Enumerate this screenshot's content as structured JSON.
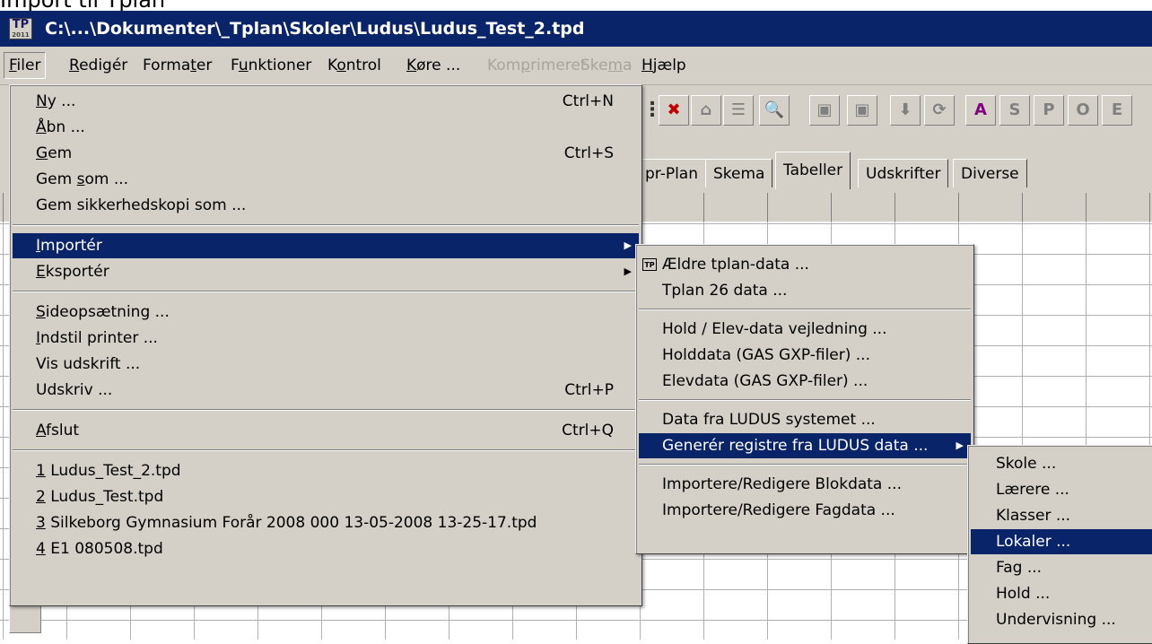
{
  "page_caption": "Import til Tplan",
  "window": {
    "title": "C:\\...\\Dokumenter\\_Tplan\\Skoler\\Ludus\\Ludus_Test_2.tpd",
    "icon_label": "TP",
    "icon_sub": "2011"
  },
  "menubar": [
    {
      "pre": "",
      "mn": "F",
      "post": "iler",
      "state": "active"
    },
    {
      "pre": "",
      "mn": "R",
      "post": "edigér",
      "state": "normal"
    },
    {
      "pre": "Forma",
      "mn": "t",
      "post": "er",
      "state": "normal"
    },
    {
      "pre": "F",
      "mn": "u",
      "post": "nktioner",
      "state": "normal"
    },
    {
      "pre": "K",
      "mn": "o",
      "post": "ntrol",
      "state": "normal"
    },
    {
      "pre": "",
      "mn": "K",
      "post": "øre ...",
      "state": "normal"
    },
    {
      "pre": "Kom",
      "mn": "p",
      "post": "rimeret",
      "state": "disabled"
    },
    {
      "pre": "Ske",
      "mn": "m",
      "post": "a",
      "state": "disabled"
    },
    {
      "pre": "",
      "mn": "H",
      "post": "jælp",
      "state": "normal"
    }
  ],
  "toolbar_buttons": [
    {
      "icon": "x-red-icon",
      "glyph": "✖",
      "color": "#c00000"
    },
    {
      "icon": "house-icon",
      "glyph": "⌂",
      "color": "#808080"
    },
    {
      "icon": "list-icon",
      "glyph": "☰",
      "color": "#808080"
    },
    {
      "icon": "search-person-icon",
      "glyph": "🔍",
      "color": "#c04000"
    },
    {
      "icon": "save-icon",
      "glyph": "▣",
      "color": "#808080"
    },
    {
      "icon": "save-as-icon",
      "glyph": "▣",
      "color": "#808080"
    },
    {
      "icon": "download-icon",
      "glyph": "⬇",
      "color": "#808080"
    },
    {
      "icon": "refresh-icon",
      "glyph": "⟳",
      "color": "#808080"
    },
    {
      "icon": "a-icon",
      "glyph": "A",
      "color": "#800080"
    },
    {
      "icon": "s-icon",
      "glyph": "S",
      "color": "#808080"
    },
    {
      "icon": "p-icon",
      "glyph": "P",
      "color": "#808080"
    },
    {
      "icon": "o-icon",
      "glyph": "O",
      "color": "#808080"
    },
    {
      "icon": "e-icon",
      "glyph": "E",
      "color": "#808080"
    }
  ],
  "tabs": [
    {
      "label": "pr-Plan",
      "selected": false
    },
    {
      "label": "Skema",
      "selected": false
    },
    {
      "label": "Tabeller",
      "selected": true
    },
    {
      "label": "Udskrifter",
      "selected": false
    },
    {
      "label": "Diverse",
      "selected": false
    }
  ],
  "filer_menu": [
    {
      "type": "item",
      "pre": "",
      "mn": "N",
      "post": "y ...",
      "shortcut": "Ctrl+N"
    },
    {
      "type": "item",
      "pre": "",
      "mn": "Å",
      "post": "bn ...",
      "shortcut": ""
    },
    {
      "type": "item",
      "pre": "",
      "mn": "G",
      "post": "em",
      "shortcut": "Ctrl+S"
    },
    {
      "type": "item",
      "pre": "Gem ",
      "mn": "s",
      "post": "om ...",
      "shortcut": ""
    },
    {
      "type": "item",
      "pre": "Gem sikkerhedskopi som ...",
      "mn": "",
      "post": "",
      "shortcut": ""
    },
    {
      "type": "sep"
    },
    {
      "type": "item",
      "pre": "",
      "mn": "I",
      "post": "mportér",
      "shortcut": "",
      "submenu": true,
      "highlight": true
    },
    {
      "type": "item",
      "pre": "",
      "mn": "E",
      "post": "ksportér",
      "shortcut": "",
      "submenu": true
    },
    {
      "type": "sep"
    },
    {
      "type": "item",
      "pre": "",
      "mn": "S",
      "post": "ideopsætning ...",
      "shortcut": ""
    },
    {
      "type": "item",
      "pre": "",
      "mn": "I",
      "post": "ndstil printer ...",
      "shortcut": ""
    },
    {
      "type": "item",
      "pre": "Vis udskrift ...",
      "mn": "",
      "post": "",
      "shortcut": ""
    },
    {
      "type": "item",
      "pre": "Udskriv ...",
      "mn": "",
      "post": "",
      "shortcut": "Ctrl+P"
    },
    {
      "type": "sep"
    },
    {
      "type": "item",
      "pre": "",
      "mn": "A",
      "post": "fslut",
      "shortcut": "Ctrl+Q"
    },
    {
      "type": "sep"
    },
    {
      "type": "item",
      "pre": "",
      "mn": "1",
      "post": " Ludus_Test_2.tpd",
      "shortcut": ""
    },
    {
      "type": "item",
      "pre": "",
      "mn": "2",
      "post": " Ludus_Test.tpd",
      "shortcut": ""
    },
    {
      "type": "item",
      "pre": "",
      "mn": "3",
      "post": " Silkeborg Gymnasium Forår 2008 000 13-05-2008 13-25-17.tpd",
      "shortcut": ""
    },
    {
      "type": "item",
      "pre": "",
      "mn": "4",
      "post": " E1 080508.tpd",
      "shortcut": ""
    }
  ],
  "import_menu": [
    {
      "type": "item",
      "label": "Ældre tplan-data ...",
      "icon": true,
      "icon_label": "TP"
    },
    {
      "type": "item",
      "label": "Tplan 26 data ..."
    },
    {
      "type": "sep"
    },
    {
      "type": "item",
      "label": "Hold / Elev-data vejledning ..."
    },
    {
      "type": "item",
      "label": "Holddata (GAS GXP-filer) ..."
    },
    {
      "type": "item",
      "label": "Elevdata (GAS GXP-filer) ..."
    },
    {
      "type": "sep"
    },
    {
      "type": "item",
      "label": "Data fra LUDUS systemet ..."
    },
    {
      "type": "item",
      "label": "Generér registre fra LUDUS data ...",
      "submenu": true,
      "highlight": true
    },
    {
      "type": "sep"
    },
    {
      "type": "item",
      "label": "Importere/Redigere Blokdata ..."
    },
    {
      "type": "item",
      "label": "Importere/Redigere Fagdata ..."
    }
  ],
  "ludus_menu": [
    {
      "label": "Skole ..."
    },
    {
      "label": "Lærere ..."
    },
    {
      "label": "Klasser ..."
    },
    {
      "label": "Lokaler ...",
      "highlight": true
    },
    {
      "label": "Fag ..."
    },
    {
      "label": "Hold ..."
    },
    {
      "label": "Undervisning ..."
    }
  ]
}
